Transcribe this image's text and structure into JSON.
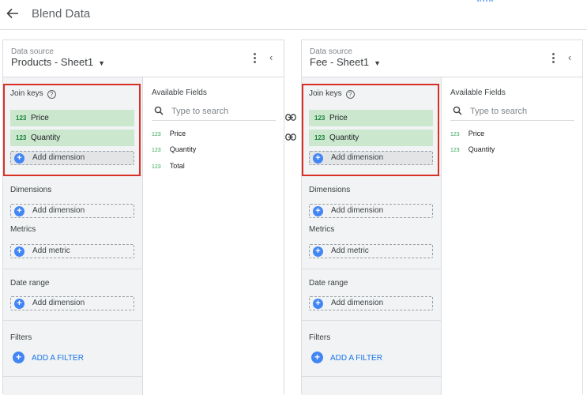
{
  "header": {
    "title": "Blend Data"
  },
  "panels": [
    {
      "source_label": "Data source",
      "source_name": "Products - Sheet1",
      "join_keys_title": "Join keys",
      "join_keys": [
        {
          "type": "123",
          "name": "Price"
        },
        {
          "type": "123",
          "name": "Quantity"
        }
      ],
      "join_add": "Add dimension",
      "dimensions_title": "Dimensions",
      "dimensions_add": "Add dimension",
      "metrics_title": "Metrics",
      "metrics_add": "Add metric",
      "date_range_title": "Date range",
      "date_range_add": "Add dimension",
      "filters_title": "Filters",
      "filters_add": "ADD A FILTER",
      "available_title": "Available Fields",
      "search_placeholder": "Type to search",
      "fields": [
        {
          "type": "123",
          "name": "Price"
        },
        {
          "type": "123",
          "name": "Quantity"
        },
        {
          "type": "123",
          "name": "Total"
        }
      ]
    },
    {
      "source_label": "Data source",
      "source_name": "Fee - Sheet1",
      "join_keys_title": "Join keys",
      "join_keys": [
        {
          "type": "123",
          "name": "Price"
        },
        {
          "type": "123",
          "name": "Quantity"
        }
      ],
      "join_add": "Add dimension",
      "dimensions_title": "Dimensions",
      "dimensions_add": "Add dimension",
      "metrics_title": "Metrics",
      "metrics_add": "Add metric",
      "date_range_title": "Date range",
      "date_range_add": "Add dimension",
      "filters_title": "Filters",
      "filters_add": "ADD A FILTER",
      "available_title": "Available Fields",
      "search_placeholder": "Type to search",
      "fields": [
        {
          "type": "123",
          "name": "Price"
        },
        {
          "type": "123",
          "name": "Quantity"
        }
      ]
    }
  ],
  "colors": {
    "join_chip": "#cbe8cf",
    "highlight_box": "#d93025",
    "accent": "#4285f4",
    "link_text": "#1a73e8"
  }
}
